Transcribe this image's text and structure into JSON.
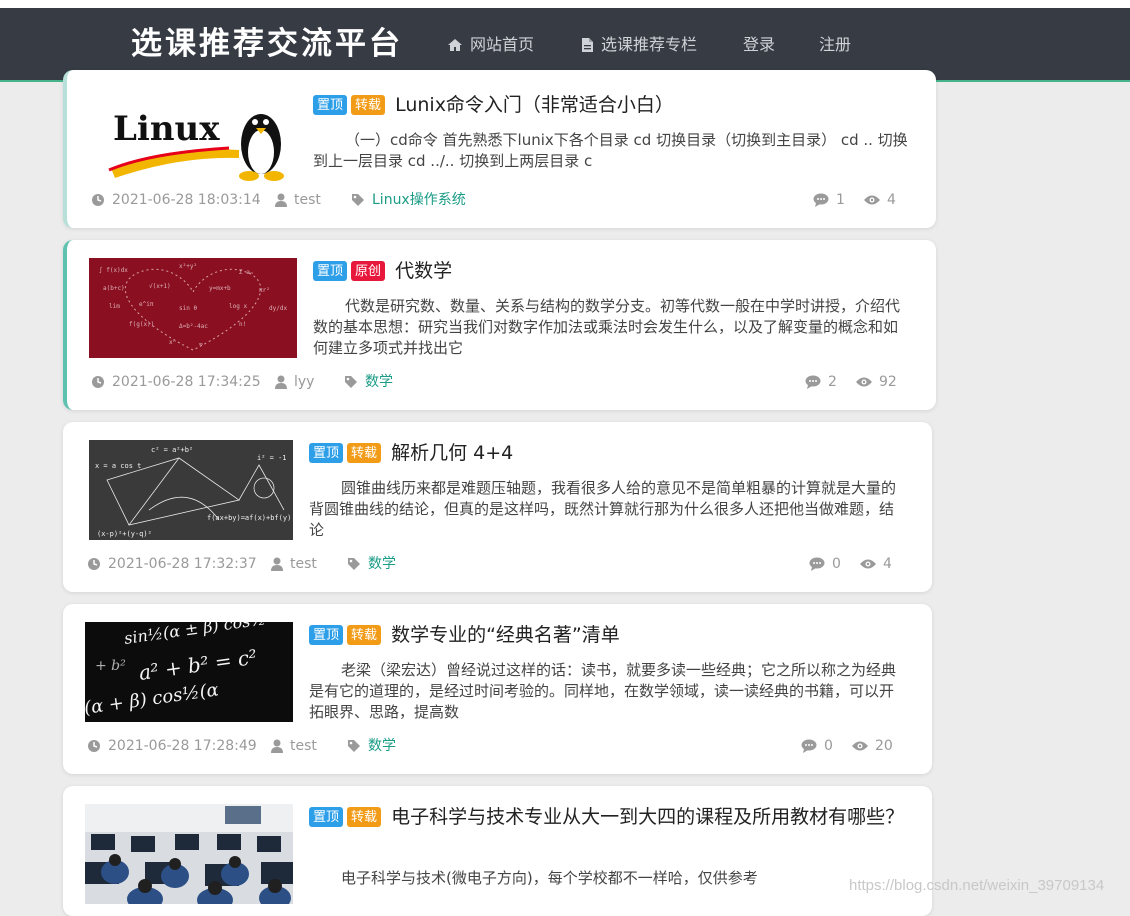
{
  "nav": {
    "brand": "选课推荐交流平台",
    "items": [
      {
        "label": "网站首页",
        "icon": "home-icon"
      },
      {
        "label": "选课推荐专栏",
        "icon": "file-icon"
      },
      {
        "label": "登录"
      },
      {
        "label": "注册"
      }
    ]
  },
  "posts": [
    {
      "tags": [
        "置顶",
        "转载"
      ],
      "title": "Lunix命令入门（非常适合小白）",
      "excerpt": "（一）cd命令 首先熟悉下lunix下各个目录 cd 切换目录（切换到主目录） cd .. 切换到上一层目录 cd ../.. 切换到上两层目录 c",
      "date": "2021-06-28 18:03:14",
      "author": "test",
      "category": "Linux操作系统",
      "comments": "1",
      "views": "4",
      "thumb": "linux-logo",
      "thumb_text": "Linux"
    },
    {
      "tags": [
        "置顶",
        "原创"
      ],
      "title": "代数学",
      "excerpt": "代数是研究数、数量、关系与结构的数学分支。初等代数一般在中学时讲授，介绍代数的基本思想：研究当我们对数字作加法或乘法时会发生什么，以及了解变量的概念和如何建立多项式并找出它",
      "date": "2021-06-28 17:34:25",
      "author": "lyy",
      "category": "数学",
      "comments": "2",
      "views": "92",
      "thumb": "algebra-heart"
    },
    {
      "tags": [
        "置顶",
        "转载"
      ],
      "title": "解析几何 4+4",
      "excerpt": "圆锥曲线历来都是难题压轴题，我看很多人给的意见不是简单粗暴的计算就是大量的背圆锥曲线的结论，但真的是这样吗，既然计算就行那为什么很多人还把他当做难题，结论",
      "date": "2021-06-28 17:32:37",
      "author": "test",
      "category": "数学",
      "comments": "0",
      "views": "4",
      "thumb": "chalkboard-geometry",
      "thumb_text": [
        "c² = a²+b²",
        "f(ax+by)=af(x)+bf(y)",
        "i² = -1"
      ]
    },
    {
      "tags": [
        "置顶",
        "转载"
      ],
      "title": "数学专业的“经典名著”清单",
      "excerpt": "老梁（梁宏达）曾经说过这样的话：读书，就要多读一些经典；它之所以称之为经典是有它的道理的，是经过时间考验的。同样地，在数学领域，读一读经典的书籍，可以开拓眼界、思路，提高数",
      "date": "2021-06-28 17:28:49",
      "author": "test",
      "category": "数学",
      "comments": "0",
      "views": "20",
      "thumb": "formula-dark",
      "thumb_text": [
        "sin½(α ± β) cos½",
        "a² + b² = c²",
        "(α + β) cos½(α"
      ]
    },
    {
      "tags": [
        "置顶",
        "转载"
      ],
      "title": "电子科学与技术专业从大一到大四的课程及所用教材有哪些？",
      "excerpt": "电子科学与技术(微电子方向)，每个学校都不一样哈，仅供参考",
      "thumb": "computer-lab"
    }
  ],
  "watermark": "https://blog.csdn.net/weixin_39709134",
  "colors": {
    "navbar": "#363b44",
    "tag_top": "#2d9ee8",
    "tag_repost": "#f29b17",
    "tag_original": "#e8183c",
    "category": "#1a9c86"
  }
}
